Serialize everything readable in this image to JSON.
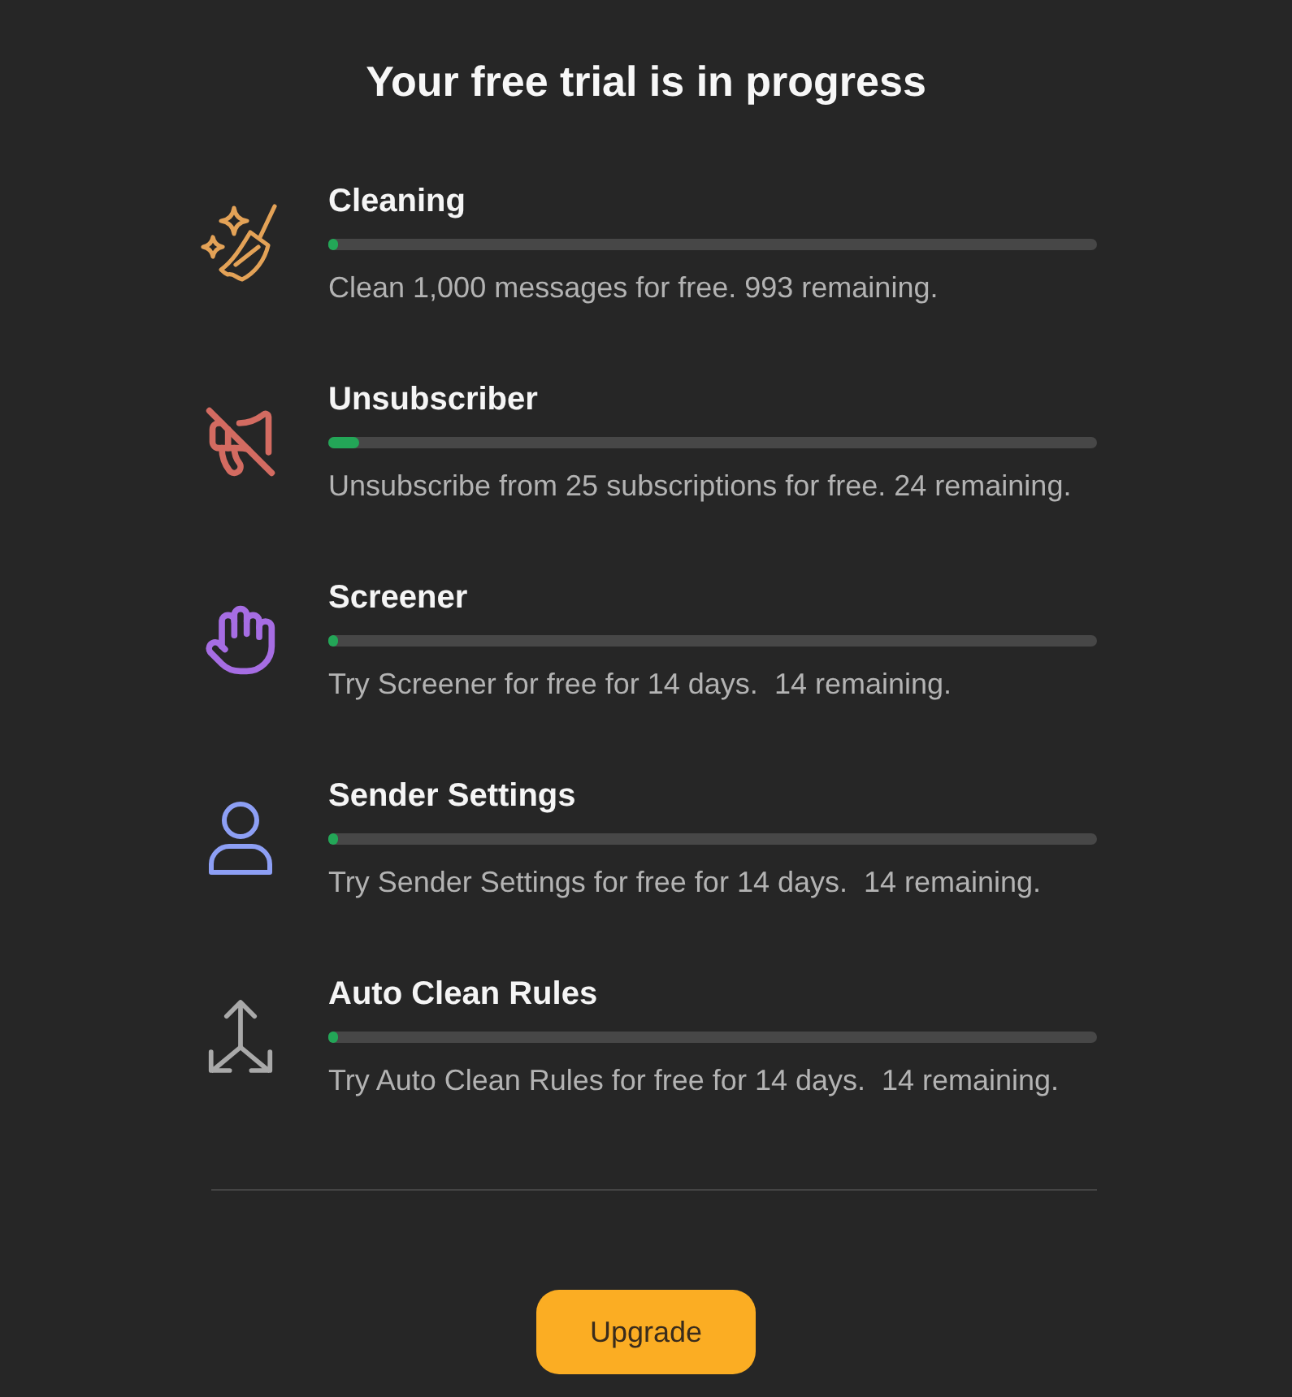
{
  "title": "Your free trial is in progress",
  "features": [
    {
      "name": "Cleaning",
      "color": "#e3a257",
      "level": 0.007,
      "description": "Clean 1,000 messages for free. 993 remaining."
    },
    {
      "name": "Unsubscriber",
      "color": "#d36b61",
      "level": 0.04,
      "description": "Unsubscribe from 25 subscriptions for free. 24 remaining."
    },
    {
      "name": "Screener",
      "color": "#a66de3",
      "level": 0,
      "description": "Try Screener for free for 14 days.  14 remaining."
    },
    {
      "name": "Sender Settings",
      "color": "#8d9ff5",
      "level": 0,
      "description": "Try Sender Settings for free for 14 days.  14 remaining."
    },
    {
      "name": "Auto Clean Rules",
      "color": "#a9a9a9",
      "level": 0,
      "description": "Try Auto Clean Rules for free for 14 days.  14 remaining."
    }
  ],
  "upgrade_button": "Upgrade"
}
